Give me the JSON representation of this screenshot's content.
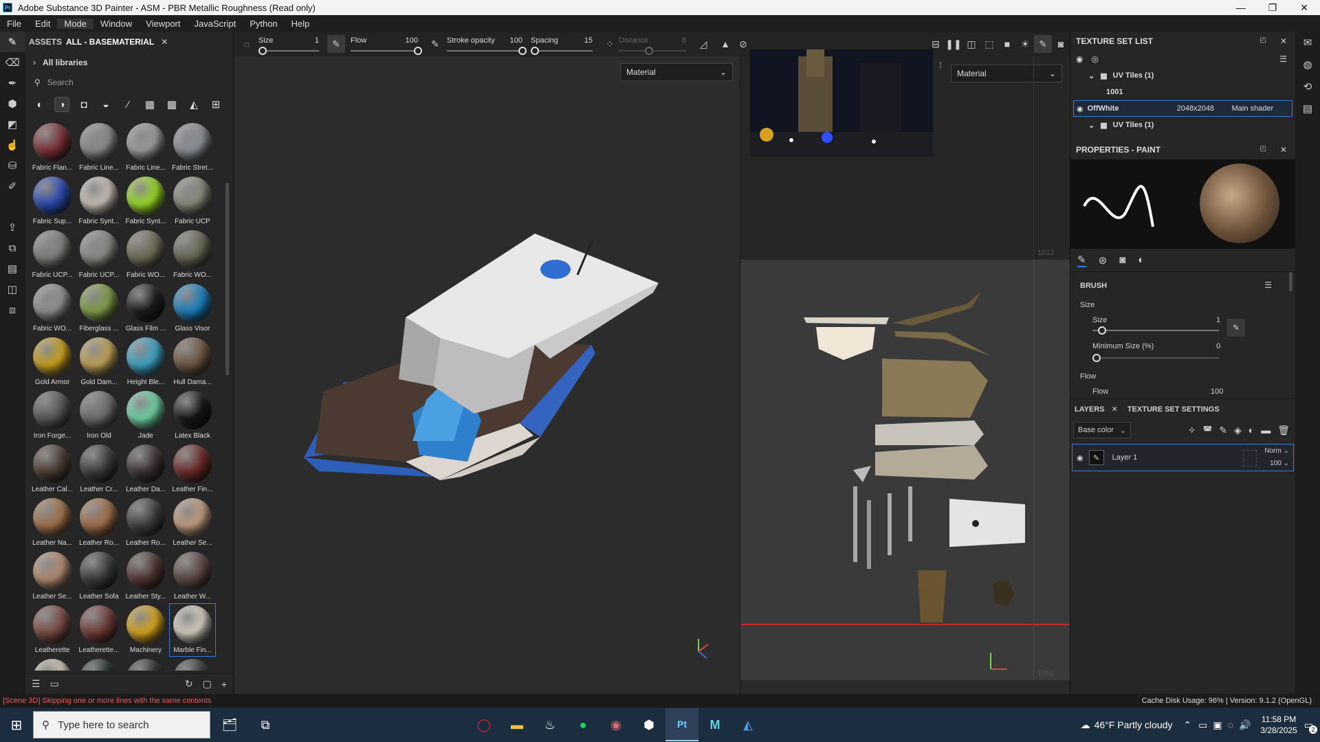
{
  "window": {
    "app_badge": "Pt",
    "title": "Adobe Substance 3D Painter - ASM - PBR Metallic Roughness (Read only)",
    "minimize": "—",
    "maximize": "❐",
    "close": "✕"
  },
  "menu": [
    "File",
    "Edit",
    "Mode",
    "Window",
    "Viewport",
    "JavaScript",
    "Python",
    "Help"
  ],
  "assets": {
    "tab_assets": "ASSETS",
    "tab_filter": "ALL - BASEMATERIAL",
    "close": "✕",
    "library": "All libraries",
    "search_placeholder": "Search",
    "materials": [
      {
        "name": "Fabric Flan...",
        "color": "#7a2d33"
      },
      {
        "name": "Fabric Line...",
        "color": "#8a8a8a"
      },
      {
        "name": "Fabric Line...",
        "color": "#9a9a9a"
      },
      {
        "name": "Fabric Stret...",
        "color": "#8b9097"
      },
      {
        "name": "Fabric Sup...",
        "color": "#2b49b0"
      },
      {
        "name": "Fabric Synt...",
        "color": "#c8beb4"
      },
      {
        "name": "Fabric Synt...",
        "color": "#98d824"
      },
      {
        "name": "Fabric UCP",
        "color": "#8a8878"
      },
      {
        "name": "Fabric UCP...",
        "color": "#7f7f7a"
      },
      {
        "name": "Fabric UCP...",
        "color": "#8a8a84"
      },
      {
        "name": "Fabric WO...",
        "color": "#6f6a55"
      },
      {
        "name": "Fabric WO...",
        "color": "#676553"
      },
      {
        "name": "Fabric WO...",
        "color": "#8f8f8f"
      },
      {
        "name": "Fiberglass ...",
        "color": "#7f9c46"
      },
      {
        "name": "Glass Film ...",
        "color": "#1a1a1a"
      },
      {
        "name": "Glass Visor",
        "color": "#1b7fc0"
      },
      {
        "name": "Gold Armor",
        "color": "#c9a11e"
      },
      {
        "name": "Gold Dam...",
        "color": "#bfa257"
      },
      {
        "name": "Height Ble...",
        "color": "#3da2c2"
      },
      {
        "name": "Hull Dama...",
        "color": "#6d5540"
      },
      {
        "name": "Iron Forge...",
        "color": "#555555"
      },
      {
        "name": "Iron Old",
        "color": "#6c6c6c"
      },
      {
        "name": "Jade",
        "color": "#6dd1a4"
      },
      {
        "name": "Latex Black",
        "color": "#151515"
      },
      {
        "name": "Leather Cal...",
        "color": "#4a3b30"
      },
      {
        "name": "Leather Cr...",
        "color": "#3a3a3a"
      },
      {
        "name": "Leather Da...",
        "color": "#3b3130"
      },
      {
        "name": "Leather Fin...",
        "color": "#6b2828"
      },
      {
        "name": "Leather Na...",
        "color": "#a07048"
      },
      {
        "name": "Leather Ro...",
        "color": "#a06d48"
      },
      {
        "name": "Leather Ro...",
        "color": "#3c3c3c"
      },
      {
        "name": "Leather Se...",
        "color": "#c09a80"
      },
      {
        "name": "Leather Se...",
        "color": "#b08b70"
      },
      {
        "name": "Leather Sofa",
        "color": "#3a3a3a"
      },
      {
        "name": "Leather Sty...",
        "color": "#4f3430"
      },
      {
        "name": "Leather W...",
        "color": "#5a4540"
      },
      {
        "name": "Leatherette",
        "color": "#7a4a42"
      },
      {
        "name": "Leatherette...",
        "color": "#6e3a36"
      },
      {
        "name": "Machinery",
        "color": "#d6a21c"
      },
      {
        "name": "Marble Fin...",
        "color": "#d4ccc0"
      },
      {
        "name": "",
        "color": "#c8c0b0"
      },
      {
        "name": "",
        "color": "#1c2a24"
      },
      {
        "name": "",
        "color": "#2b2b2b"
      },
      {
        "name": "",
        "color": "#333333"
      }
    ],
    "selected_index": 39
  },
  "toolbar": {
    "size_label": "Size",
    "size_value": "1",
    "flow_label": "Flow",
    "flow_value": "100",
    "stroke_label": "Stroke opacity",
    "stroke_value": "100",
    "spacing_label": "Spacing",
    "spacing_value": "15",
    "distance_label": "Distance",
    "distance_value": "8"
  },
  "viewport": {
    "material_dropdown_3d": "Material",
    "material_dropdown_2d": "Material",
    "uv_tag_upper": "1012",
    "uv_tag_lower": "1002"
  },
  "texture_set_list": {
    "title": "TEXTURE SET LIST",
    "uv_tiles_1": "UV Tiles (1)",
    "tile_1001": "1001",
    "set_name": "OffWhite",
    "set_res": "2048x2048",
    "set_shader": "Main shader",
    "uv_tiles_2": "UV Tiles (1)"
  },
  "properties": {
    "title": "PROPERTIES - PAINT",
    "brush_heading": "BRUSH",
    "size_group": "Size",
    "size_label": "Size",
    "size_value": "1",
    "min_size_label": "Minimum Size (%)",
    "min_size_value": "0",
    "flow_group": "Flow",
    "flow_label": "Flow",
    "flow_value": "100"
  },
  "layers": {
    "tab_layers": "LAYERS",
    "tab_tss": "TEXTURE SET SETTINGS",
    "channel": "Base color",
    "layer_name": "Layer 1",
    "blend": "Norm",
    "opacity": "100"
  },
  "status": {
    "message": "[Scene 3D] Skipping one or more lines with the same contents",
    "cache": "Cache Disk Usage:   96% | Version: 9.1.2 (OpenGL)"
  },
  "taskbar": {
    "search_placeholder": "Type here to search",
    "weather": "46°F  Partly cloudy",
    "time": "11:58 PM",
    "date": "3/28/2025",
    "notif_count": "2"
  }
}
